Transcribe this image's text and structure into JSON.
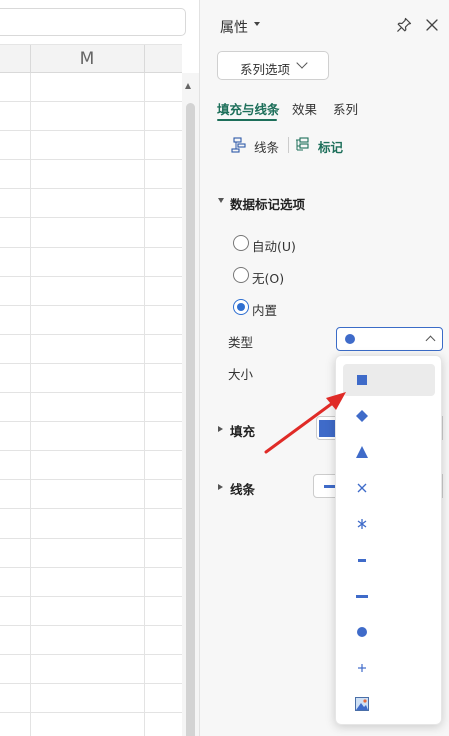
{
  "sheet": {
    "column_header": "M",
    "row_count": 23
  },
  "pane": {
    "title": "属性",
    "series_dropdown": "系列选项",
    "tabs": [
      {
        "label": "填充与线条",
        "active": true
      },
      {
        "label": "效果",
        "active": false
      },
      {
        "label": "系列",
        "active": false
      }
    ],
    "subtabs": {
      "line": "线条",
      "marker": "标记"
    },
    "marker_options_section": "数据标记选项",
    "radios": [
      {
        "label": "自动(U)",
        "checked": false
      },
      {
        "label": "无(O)",
        "checked": false
      },
      {
        "label": "内置",
        "checked": true
      }
    ],
    "type_label": "类型",
    "size_label": "大小",
    "fill_section": "填充",
    "line_section": "线条"
  },
  "marker_menu": {
    "items": [
      "square-marker",
      "diamond-marker",
      "triangle-marker",
      "x-marker",
      "star-marker",
      "short-dash-marker",
      "long-dash-marker",
      "circle-marker",
      "plus-marker",
      "picture-marker"
    ],
    "selected_index": 0
  },
  "colors": {
    "accent": "#1d6f5a",
    "marker_blue": "#3f6bc9",
    "arrow_red": "#e02b27"
  }
}
